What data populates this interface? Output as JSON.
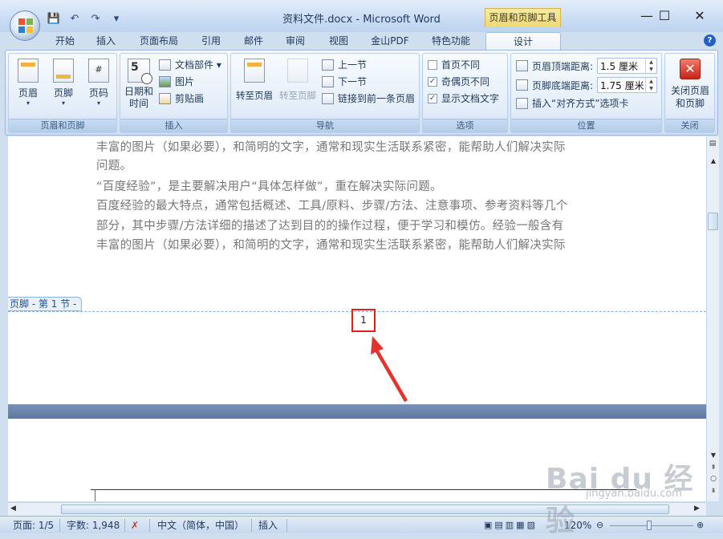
{
  "window": {
    "title": "资料文件.docx - Microsoft Word",
    "context_tab_title": "页眉和页脚工具",
    "min": "—",
    "max": "☐",
    "close": "✕"
  },
  "qat": {
    "save": "💾",
    "undo": "↶",
    "redo": "↷",
    "more": "▾"
  },
  "tabs": [
    "开始",
    "插入",
    "页面布局",
    "引用",
    "邮件",
    "审阅",
    "视图",
    "金山PDF",
    "特色功能",
    "设计"
  ],
  "help": "?",
  "ribbon": {
    "header_footer_group": {
      "label": "页眉和页脚",
      "buttons": [
        "页眉",
        "页脚",
        "页码"
      ]
    },
    "insert_group": {
      "label": "插入",
      "datetime": [
        "日期和",
        "时间"
      ],
      "items": [
        "文档部件 ▾",
        "图片",
        "剪贴画"
      ]
    },
    "nav_group": {
      "label": "导航",
      "goto_header": "转至页眉",
      "goto_footer": "转至页脚",
      "items": [
        "上一节",
        "下一节",
        "链接到前一条页眉"
      ]
    },
    "options_group": {
      "label": "选项",
      "items": [
        {
          "label": "首页不同",
          "checked": false
        },
        {
          "label": "奇偶页不同",
          "checked": true
        },
        {
          "label": "显示文档文字",
          "checked": true
        }
      ]
    },
    "position_group": {
      "label": "位置",
      "header_distance_label": "页眉顶端距离:",
      "header_distance_value": "1.5 厘米",
      "footer_distance_label": "页脚底端距离:",
      "footer_distance_value": "1.75 厘米",
      "insert_align_tab": "插入“对齐方式”选项卡"
    },
    "close_group": {
      "label": "关闭",
      "close_button": [
        "关闭页眉",
        "和页脚"
      ]
    }
  },
  "document": {
    "lines": [
      "丰富的图片（如果必要），和简明的文字，通常和现实生活联系紧密，能帮助人们解决实际",
      "问题。",
      "“百度经验”，是主要解决用户“具体怎样做”，重在解决实际问题。",
      "百度经验的最大特点，通常包括概述、工具/原料、步骤/方法、注意事项、参考资料等几个",
      "部分，其中步骤/方法详细的描述了达到目的的操作过程，便于学习和模仿。经验一般含有",
      "丰富的图片（如果必要），和简明的文字，通常和现实生活联系紧密，能帮助人们解决实际"
    ],
    "footer_tag": "页脚 - 第 1 节 -",
    "page_number": "1"
  },
  "statusbar": {
    "page": "页面: 1/5",
    "words": "字数: 1,948",
    "language": "中文（简体，中国）",
    "mode": "插入",
    "zoom": "120%"
  },
  "watermark": {
    "text": "Bai du 经验",
    "url": "jingyan.baidu.com"
  },
  "colors": {
    "accent": "#e01f1f",
    "ribbon": "#dbe7f6",
    "page_gap": "#5d77a0"
  }
}
